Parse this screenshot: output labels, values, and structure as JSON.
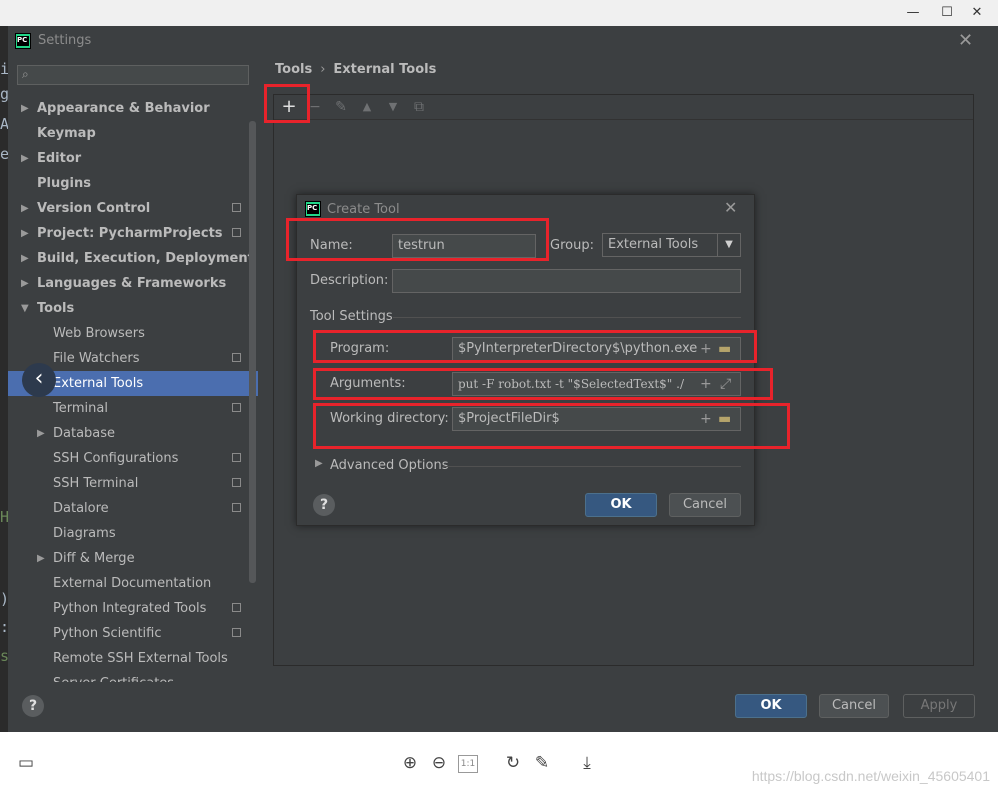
{
  "viewer": {
    "window_controls": [
      "—",
      "☐",
      "✕"
    ],
    "bottom_icons": [
      "monitor-icon",
      "zoom-in-icon",
      "zoom-out-icon",
      "actual-size-icon",
      "rotate-icon",
      "edit-icon",
      "download-icon"
    ],
    "actual_size_label": "1:1",
    "watermark": "https://blog.csdn.net/weixin_45605401"
  },
  "editor_peek": [
    "i",
    "g",
    "A",
    "e",
    "H",
    ")",
    ":",
    "s",
    "e\")"
  ],
  "settings": {
    "title": "Settings",
    "logo": "PC",
    "search_placeholder": "",
    "tree": [
      {
        "label": "Appearance & Behavior",
        "bold": true,
        "arrow": "▶"
      },
      {
        "label": "Keymap",
        "bold": true
      },
      {
        "label": "Editor",
        "bold": true,
        "arrow": "▶"
      },
      {
        "label": "Plugins",
        "bold": true
      },
      {
        "label": "Version Control",
        "bold": true,
        "arrow": "▶",
        "proj": true
      },
      {
        "label": "Project: PycharmProjects",
        "bold": true,
        "arrow": "▶",
        "proj": true
      },
      {
        "label": "Build, Execution, Deployment",
        "bold": true,
        "arrow": "▶"
      },
      {
        "label": "Languages & Frameworks",
        "bold": true,
        "arrow": "▶"
      },
      {
        "label": "Tools",
        "bold": true,
        "arrow": "▼"
      },
      {
        "label": "Web Browsers",
        "indent": true
      },
      {
        "label": "File Watchers",
        "indent": true,
        "proj": true
      },
      {
        "label": "External Tools",
        "indent": true,
        "selected": true
      },
      {
        "label": "Terminal",
        "indent": true,
        "proj": true
      },
      {
        "label": "Database",
        "indent": true,
        "arrow": "▶"
      },
      {
        "label": "SSH Configurations",
        "indent": true,
        "proj": true
      },
      {
        "label": "SSH Terminal",
        "indent": true,
        "proj": true
      },
      {
        "label": "Datalore",
        "indent": true,
        "proj": true
      },
      {
        "label": "Diagrams",
        "indent": true
      },
      {
        "label": "Diff & Merge",
        "indent": true,
        "arrow": "▶"
      },
      {
        "label": "External Documentation",
        "indent": true
      },
      {
        "label": "Python Integrated Tools",
        "indent": true,
        "proj": true
      },
      {
        "label": "Python Scientific",
        "indent": true,
        "proj": true
      },
      {
        "label": "Remote SSH External Tools",
        "indent": true
      },
      {
        "label": "Server Certificates",
        "indent": true
      }
    ],
    "breadcrumb": [
      "Tools",
      "External Tools"
    ],
    "breadcrumb_sep": "›",
    "toolbar": [
      "+",
      "−",
      "✎",
      "▲",
      "▼",
      "⧉"
    ],
    "buttons": {
      "ok": "OK",
      "cancel": "Cancel",
      "apply": "Apply",
      "help": "?"
    }
  },
  "create_tool": {
    "title": "Create Tool",
    "logo": "PC",
    "name_label": "Name:",
    "name_value": "testrun",
    "group_label": "Group:",
    "group_value": "External Tools",
    "description_label": "Description:",
    "description_value": "",
    "tool_settings_label": "Tool Settings",
    "program_label": "Program:",
    "program_value": "$PyInterpreterDirectory$\\python.exe",
    "arguments_label": "Arguments:",
    "arguments_value": "put -F robot.txt -t \"$SelectedText$\" ./",
    "workdir_label": "Working directory:",
    "workdir_value": "$ProjectFileDir$",
    "advanced_label": "Advanced Options",
    "ok": "OK",
    "cancel": "Cancel",
    "help": "?",
    "close": "✕"
  },
  "colors": {
    "annotation_red": "#e8232b",
    "selection_blue": "#4b6eaf",
    "primary_button": "#365880"
  }
}
